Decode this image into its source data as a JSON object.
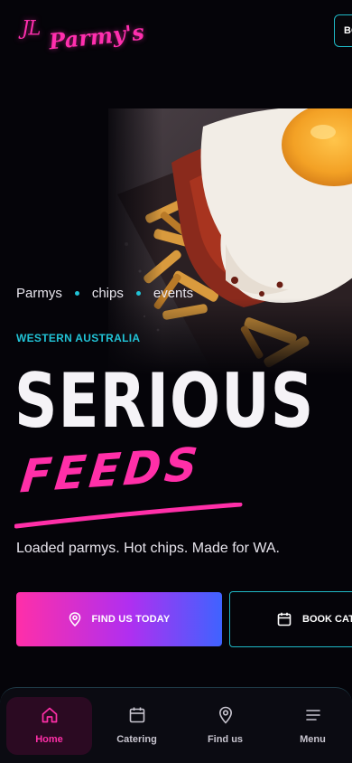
{
  "header": {
    "logo_initials": "JL",
    "logo_script": "Parmy's",
    "cta_label": "BOOK"
  },
  "hero": {
    "tags": [
      "Parmys",
      "chips",
      "events"
    ],
    "eyebrow": "WESTERN AUSTRALIA",
    "headline": "SERIOUS",
    "accent": "FEEDS",
    "subtitle": "Loaded parmys. Hot chips. Made for WA.",
    "primary_cta": "FIND US TODAY",
    "secondary_cta": "BOOK CATERING"
  },
  "nav": {
    "items": [
      {
        "label": "Home",
        "icon": "home-icon",
        "active": true
      },
      {
        "label": "Catering",
        "icon": "calendar-icon",
        "active": false
      },
      {
        "label": "Find us",
        "icon": "map-pin-icon",
        "active": false
      },
      {
        "label": "Menu",
        "icon": "menu-icon",
        "active": false
      }
    ]
  },
  "colors": {
    "background": "#050409",
    "brand_pink": "#ff2fa8",
    "accent_cyan": "#21c3d6",
    "gradient_end": "#3f63ff"
  }
}
